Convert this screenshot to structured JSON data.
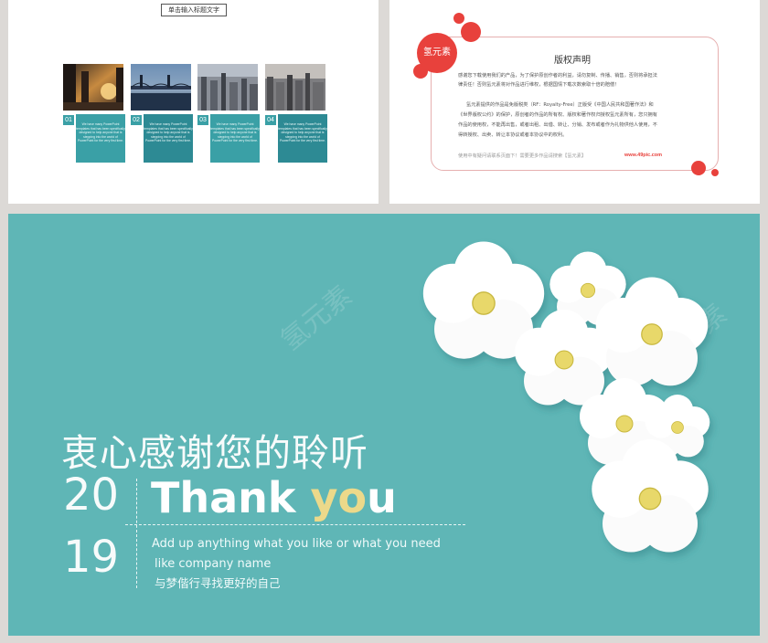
{
  "slide1": {
    "title_box": "单击输入标题文字",
    "cards": [
      {
        "num": "01",
        "text": "We have many PowerPoint templates that has been specifically designed to help anyone that is stepping into the world of PowerPoint for the very first time."
      },
      {
        "num": "02",
        "text": "We have many PowerPoint templates that has been specifically designed to help anyone that is stepping into the world of PowerPoint for the very first time."
      },
      {
        "num": "03",
        "text": "We have many PowerPoint templates that has been specifically designed to help anyone that is stepping into the world of PowerPoint for the very first time."
      },
      {
        "num": "04",
        "text": "We have many PowerPoint templates that has been specifically designed to help anyone that is stepping into the world of PowerPoint for the very first time."
      }
    ]
  },
  "slide2": {
    "badge": "氢元素",
    "title": "版权声明",
    "para1_l1": "感谢您下载使用我们的产品，为了保护原创作者的利益，请勿复制、传播、销售，否则将承担法",
    "para1_l2": "律责任！否则氢元素将对作品进行维权，根据国情下载次数索取十倍的赔偿！",
    "para2_l1": "氢元素提供的作品是免版税类（RF：Royalty-Free）正版受《中国人民共和国著作法》和",
    "para2_l2": "《世界版权公约》的保护，原创者的作品的所有权、版权和著作权归授权氢元素所有，您只拥有",
    "para2_l3": "作品的使用权，不能再出售，或者出租、出借、转让、分销、发布或者作为礼物供他人使用，不",
    "para2_l4": "得转授权、出卖、转让本协议或者本协议中的权利。",
    "footer": "使用中有疑问请联系页面下！需要更多作品请搜索【氢元素】",
    "url": "www.49pic.com"
  },
  "slide3": {
    "heading_cn": "衷心感谢您的聆听",
    "year_top": "20",
    "year_bottom": "19",
    "thank_a": "Thank ",
    "thank_b": "yo",
    "thank_c": "u",
    "sub_en_1": "Add up anything what you like or what you need",
    "sub_en_2": "like company name",
    "sub_cn": "与梦偕行寻找更好的自己",
    "watermark": "氢元素"
  },
  "colors": {
    "teal": "#5fb6b6",
    "card_teal": "#3aa0a6",
    "accent_red": "#e8413c",
    "accent_yellow": "#ecd98a"
  }
}
